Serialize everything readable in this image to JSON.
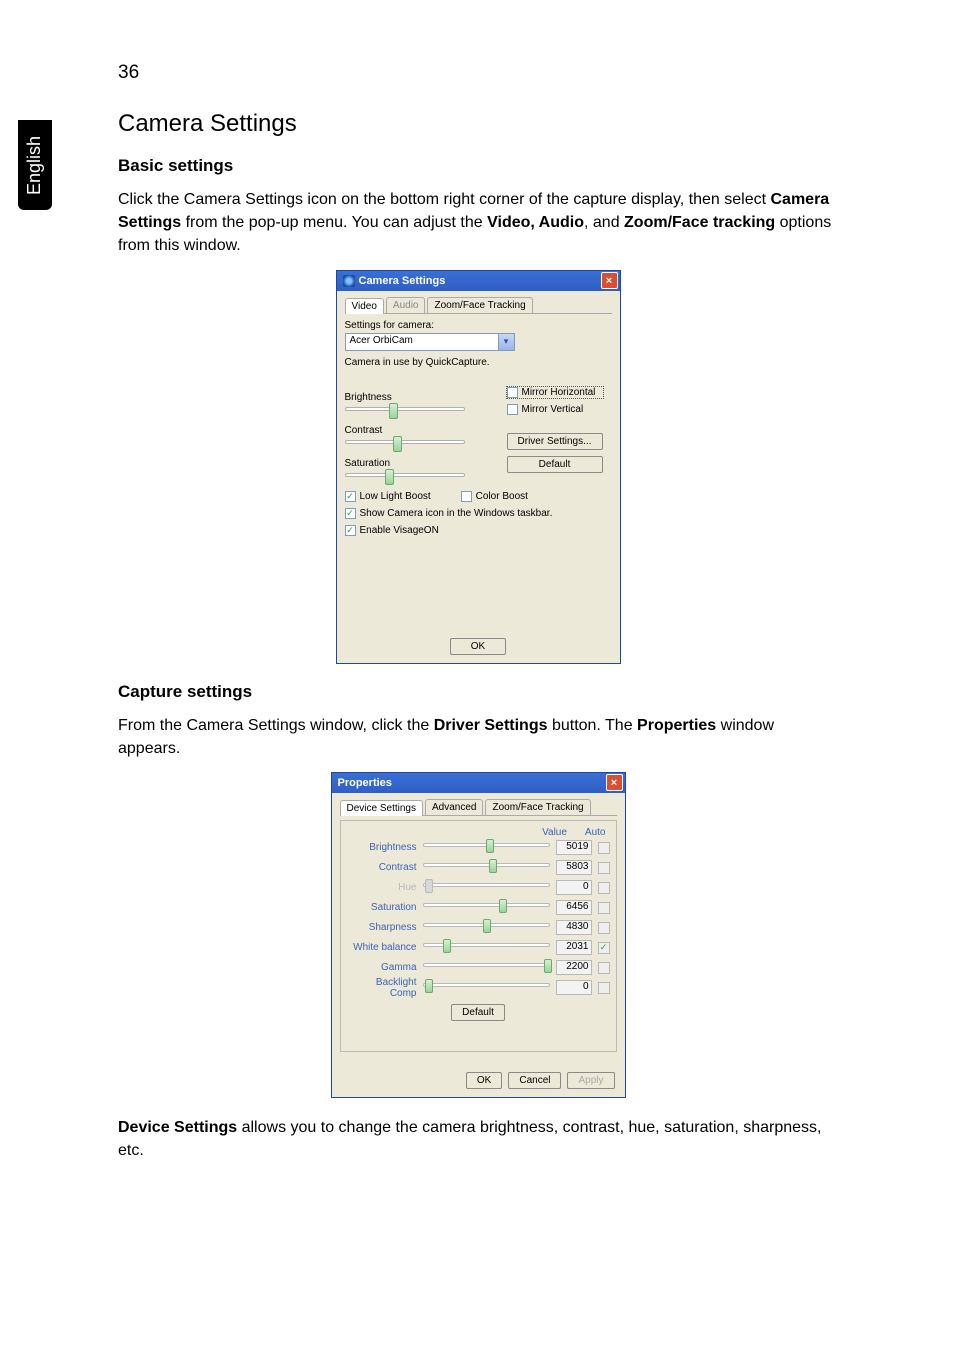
{
  "page": {
    "number": "36",
    "sidetab": "English"
  },
  "headings": {
    "h1": "Camera Settings",
    "basic": "Basic settings",
    "capture": "Capture settings"
  },
  "paragraphs": {
    "p1_a": "Click the Camera Settings icon on the bottom right corner of the capture display, then select ",
    "p1_b": "Camera Settings",
    "p1_c": " from the pop-up menu. You can adjust the ",
    "p1_d": "Video, Audio",
    "p1_e": ", and ",
    "p1_f": "Zoom/Face tracking",
    "p1_g": " options from this window.",
    "p2_a": "From the Camera Settings window, click the ",
    "p2_b": "Driver Settings",
    "p2_c": " button. The ",
    "p2_d": "Properties",
    "p2_e": " window appears.",
    "p3_a": "Device Settings",
    "p3_b": " allows you to change the camera brightness, contrast, hue, saturation, sharpness, etc."
  },
  "dlg1": {
    "title": "Camera Settings",
    "tabs": [
      "Video",
      "Audio",
      "Zoom/Face Tracking"
    ],
    "settings_for_camera": "Settings for camera:",
    "camera_select": "Acer OrbiCam",
    "in_use": "Camera in use by QuickCapture.",
    "brightness": "Brightness",
    "contrast": "Contrast",
    "saturation": "Saturation",
    "mirror_h": "Mirror Horizontal",
    "mirror_v": "Mirror Vertical",
    "driver_settings_btn": "Driver Settings...",
    "default_btn": "Default",
    "low_light": "Low Light Boost",
    "color_boost": "Color Boost",
    "show_taskbar": "Show Camera icon in the Windows taskbar.",
    "enable_visageon": "Enable VisageON",
    "ok": "OK",
    "close": "×"
  },
  "dlg2": {
    "title": "Properties",
    "tabs": [
      "Device Settings",
      "Advanced",
      "Zoom/Face Tracking"
    ],
    "col_value": "Value",
    "col_auto": "Auto",
    "rows": [
      {
        "label": "Brightness",
        "value": "5019",
        "pos": 50,
        "auto": false,
        "disabled": false
      },
      {
        "label": "Contrast",
        "value": "5803",
        "pos": 52,
        "auto": false,
        "disabled": false
      },
      {
        "label": "Hue",
        "value": "0",
        "pos": 2,
        "auto": false,
        "disabled": true
      },
      {
        "label": "Saturation",
        "value": "6456",
        "pos": 60,
        "auto": false,
        "disabled": false
      },
      {
        "label": "Sharpness",
        "value": "4830",
        "pos": 48,
        "auto": false,
        "disabled": false
      },
      {
        "label": "White balance",
        "value": "2031",
        "pos": 16,
        "auto": true,
        "disabled": false
      },
      {
        "label": "Gamma",
        "value": "2200",
        "pos": 96,
        "auto": false,
        "disabled": false
      },
      {
        "label": "Backlight Comp",
        "value": "0",
        "pos": 2,
        "auto": false,
        "disabled": false
      }
    ],
    "default_btn": "Default",
    "ok": "OK",
    "cancel": "Cancel",
    "apply": "Apply",
    "close": "×"
  }
}
